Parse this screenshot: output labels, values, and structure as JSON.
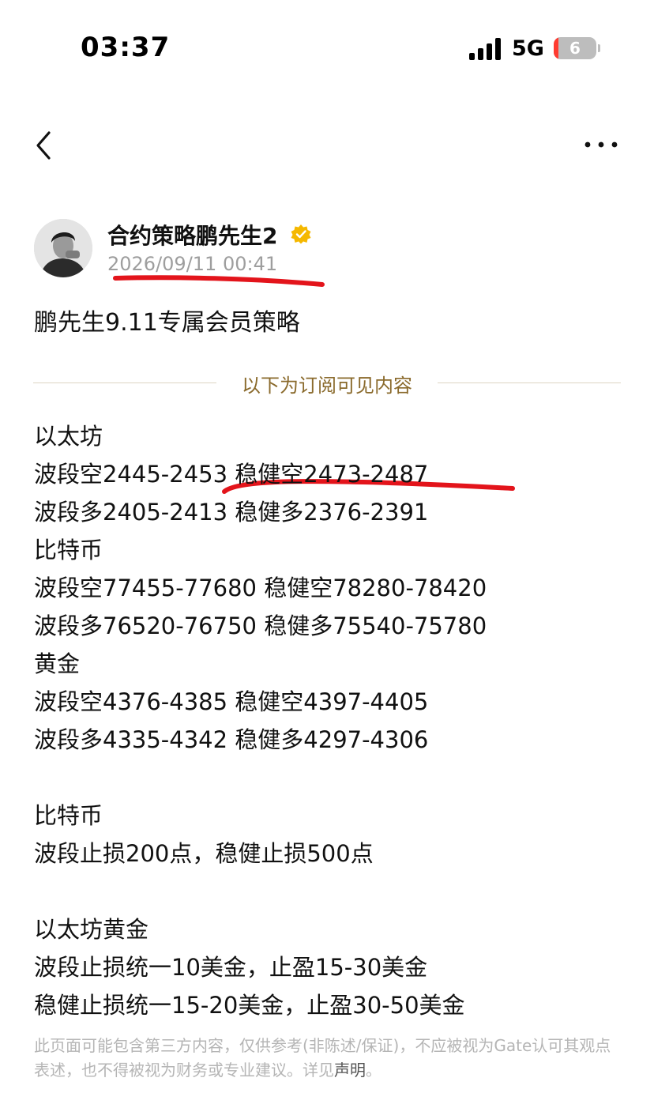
{
  "status_bar": {
    "time": "03:37",
    "network": "5G",
    "battery": "6"
  },
  "nav": {
    "back_icon": "chevron-left-icon",
    "more_icon": "more-horizontal-icon"
  },
  "author": {
    "name": "合约策略鹏先生2",
    "badge_icon": "verified-badge-icon",
    "timestamp": "2026/09/11 00:41"
  },
  "post": {
    "title": "鹏先生9.11专属会员策略"
  },
  "divider": {
    "label": "以下为订阅可见内容"
  },
  "content_lines": [
    "以太坊",
    "波段空2445-2453 稳健空2473-2487",
    "波段多2405-2413 稳健多2376-2391",
    "比特币",
    "波段空77455-77680 稳健空78280-78420",
    "波段多76520-76750 稳健多75540-75780",
    "黄金",
    "波段空4376-4385 稳健空4397-4405",
    "波段多4335-4342 稳健多4297-4306",
    "",
    "比特币",
    "波段止损200点，稳健止损500点",
    "",
    "以太坊黄金",
    "波段止损统一10美金，止盈15-30美金",
    "稳健止损统一15-20美金，止盈30-50美金"
  ],
  "disclaimer": {
    "text": "此页面可能包含第三方内容，仅供参考(非陈述/保证)，不应被视为Gate认可其观点表述，也不得被视为财务或专业建议。详见",
    "link": "声明",
    "suffix": "。"
  },
  "colors": {
    "annotation_red": "#e3141b",
    "verified_gold": "#f5b800",
    "divider_label": "#8a6a2c"
  }
}
